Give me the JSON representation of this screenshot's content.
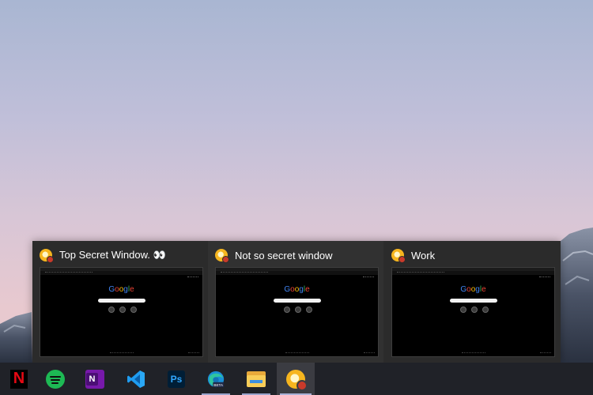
{
  "preview_flyout": {
    "windows": [
      {
        "title": "Top Secret Window. 👀",
        "app_icon": "chrome-canary-icon",
        "search_brand": "Google"
      },
      {
        "title": "Not so secret window",
        "app_icon": "chrome-canary-icon",
        "search_brand": "Google"
      },
      {
        "title": "Work",
        "app_icon": "chrome-canary-icon",
        "search_brand": "Google"
      }
    ]
  },
  "taskbar": {
    "apps": [
      {
        "name": "Netflix",
        "icon": "netflix-icon",
        "glyph": "N",
        "state": "pinned"
      },
      {
        "name": "Spotify",
        "icon": "spotify-icon",
        "state": "pinned"
      },
      {
        "name": "OneNote",
        "icon": "onenote-icon",
        "glyph": "N",
        "state": "pinned"
      },
      {
        "name": "Visual Studio Code",
        "icon": "vscode-icon",
        "state": "pinned"
      },
      {
        "name": "Photoshop",
        "icon": "photoshop-icon",
        "glyph": "Ps",
        "state": "pinned"
      },
      {
        "name": "Edge Beta",
        "icon": "edge-beta-icon",
        "badge": "BETA",
        "state": "running"
      },
      {
        "name": "File Explorer",
        "icon": "file-explorer-icon",
        "state": "running"
      },
      {
        "name": "Chrome Canary",
        "icon": "chrome-canary-icon",
        "state": "active"
      }
    ]
  },
  "colors": {
    "taskbar_bg": "#202228",
    "flyout_bg": "#2b2b2b",
    "active_item_bg": "#3b3c42",
    "indicator": "#a9b1d6"
  }
}
